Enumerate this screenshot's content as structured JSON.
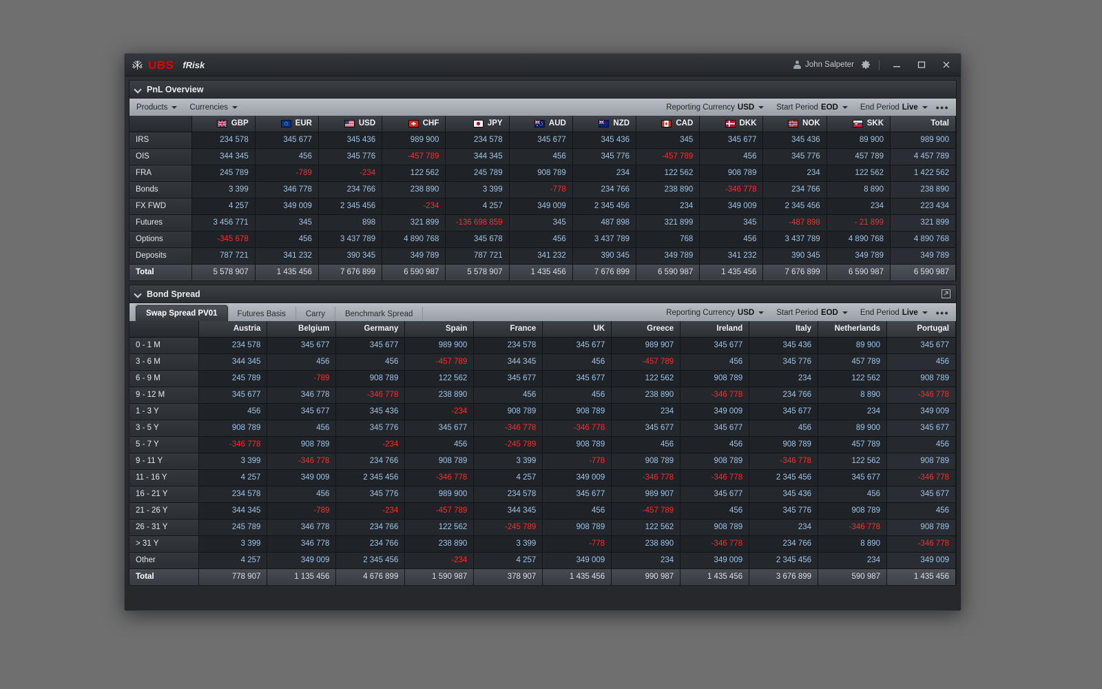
{
  "titlebar": {
    "brand": "UBS",
    "product": "fRisk",
    "user": "John Salpeter",
    "icons": {
      "user": "user-icon",
      "gear": "gear-icon",
      "minimize": "minimize-icon",
      "maximize": "maximize-icon",
      "close": "close-icon"
    }
  },
  "pnl": {
    "title": "PnL Overview",
    "toolbar_left": [
      {
        "label": "Products"
      },
      {
        "label": "Currencies"
      }
    ],
    "toolbar_right": [
      {
        "label": "Reporting Currency",
        "value": "USD"
      },
      {
        "label": "Start Period",
        "value": "EOD"
      },
      {
        "label": "End Period",
        "value": "Live"
      }
    ],
    "more": "•••",
    "row_header": "",
    "columns": [
      {
        "code": "GBP",
        "flag": "gb"
      },
      {
        "code": "EUR",
        "flag": "eu"
      },
      {
        "code": "USD",
        "flag": "us"
      },
      {
        "code": "CHF",
        "flag": "ch"
      },
      {
        "code": "JPY",
        "flag": "jp"
      },
      {
        "code": "AUD",
        "flag": "au"
      },
      {
        "code": "NZD",
        "flag": "nz"
      },
      {
        "code": "CAD",
        "flag": "ca"
      },
      {
        "code": "DKK",
        "flag": "dk"
      },
      {
        "code": "NOK",
        "flag": "no"
      },
      {
        "code": "SKK",
        "flag": "sk"
      }
    ],
    "total_column": "Total",
    "rows": [
      {
        "label": "IRS",
        "values": [
          "234 578",
          "345 677",
          "345 436",
          "989 900",
          "234 578",
          "345 677",
          "345 436",
          "345",
          "345 677",
          "345 436",
          "89 900"
        ],
        "total": "989 900"
      },
      {
        "label": "OIS",
        "values": [
          "344 345",
          "456",
          "345 776",
          "-457 789",
          "344 345",
          "456",
          "345 776",
          "-457 789",
          "456",
          "345 776",
          "457 789"
        ],
        "total": "4 457 789"
      },
      {
        "label": "FRA",
        "values": [
          "245 789",
          "-789",
          "-234",
          "122 562",
          "245 789",
          "908 789",
          "234",
          "122 562",
          "908 789",
          "234",
          "122 562"
        ],
        "total": "1 422 562"
      },
      {
        "label": "Bonds",
        "values": [
          "3 399",
          "346 778",
          "234 766",
          "238 890",
          "3 399",
          "-778",
          "234 766",
          "238 890",
          "-346 778",
          "234 766",
          "8 890"
        ],
        "total": "238 890"
      },
      {
        "label": "FX FWD",
        "values": [
          "4 257",
          "349 009",
          "2 345 456",
          "-234",
          "4 257",
          "349 009",
          "2 345 456",
          "234",
          "349 009",
          "2 345 456",
          "234"
        ],
        "total": "223 434"
      },
      {
        "label": "Futures",
        "values": [
          "3 456 771",
          "345",
          "898",
          "321 899",
          "-136 698 859",
          "345",
          "487 898",
          "321 899",
          "345",
          "-487 898",
          "- 21 899"
        ],
        "total": "321 899"
      },
      {
        "label": "Options",
        "values": [
          "-345 678",
          "456",
          "3 437 789",
          "4 890 768",
          "345 678",
          "456",
          "3 437 789",
          "768",
          "456",
          "3 437 789",
          "4 890 768"
        ],
        "total": "4 890 768"
      },
      {
        "label": "Deposits",
        "values": [
          "787 721",
          "341 232",
          "390 345",
          "349 789",
          "787 721",
          "341 232",
          "390 345",
          "349 789",
          "341 232",
          "390 345",
          "349 789"
        ],
        "total": "349 789"
      }
    ],
    "total_row": {
      "label": "Total",
      "values": [
        "5 578 907",
        "1 435 456",
        "7 676 899",
        "6 590 987",
        "5 578 907",
        "1 435 456",
        "7 676 899",
        "6 590 987",
        "1 435 456",
        "7 676 899",
        "6 590 987"
      ],
      "total": "6 590 987"
    }
  },
  "bond": {
    "title": "Bond Spread",
    "popout_icon": "popout-icon",
    "tabs": [
      {
        "label": "Swap Spread PV01",
        "active": true
      },
      {
        "label": "Futures Basis",
        "active": false
      },
      {
        "label": "Carry",
        "active": false
      },
      {
        "label": "Benchmark Spread",
        "active": false
      }
    ],
    "toolbar_right": [
      {
        "label": "Reporting Currency",
        "value": "USD"
      },
      {
        "label": "Start Period",
        "value": "EOD"
      },
      {
        "label": "End Period",
        "value": "Live"
      }
    ],
    "more": "•••",
    "columns": [
      "Austria",
      "Belgium",
      "Germany",
      "Spain",
      "France",
      "UK",
      "Greece",
      "Ireland",
      "Italy",
      "Netherlands",
      "Portugal"
    ],
    "rows": [
      {
        "label": "0 - 1 M",
        "values": [
          "234 578",
          "345 677",
          "345 677",
          "989 900",
          "234 578",
          "345 677",
          "989 907",
          "345 677",
          "345 436",
          "89 900",
          "345 677"
        ]
      },
      {
        "label": "3 - 6 M",
        "values": [
          "344 345",
          "456",
          "456",
          "-457 789",
          "344 345",
          "456",
          "-457 789",
          "456",
          "345 776",
          "457 789",
          "456"
        ]
      },
      {
        "label": "6 - 9 M",
        "values": [
          "245 789",
          "-789",
          "908 789",
          "122 562",
          "345 677",
          "345 677",
          "122 562",
          "908 789",
          "234",
          "122 562",
          "908 789"
        ]
      },
      {
        "label": "9 - 12 M",
        "values": [
          "345 677",
          "346 778",
          "-346 778",
          "238 890",
          "456",
          "456",
          "238 890",
          "-346 778",
          "234 766",
          "8 890",
          "-346 778"
        ]
      },
      {
        "label": "1 - 3 Y",
        "values": [
          "456",
          "345 677",
          "345 436",
          "-234",
          "908 789",
          "908 789",
          "234",
          "349 009",
          "345 677",
          "234",
          "349 009"
        ]
      },
      {
        "label": "3 - 5 Y",
        "values": [
          "908 789",
          "456",
          "345 776",
          "345 677",
          "-346 778",
          "-346 778",
          "345 677",
          "345 677",
          "456",
          "89 900",
          "345 677"
        ]
      },
      {
        "label": "5 - 7 Y",
        "values": [
          "-346 778",
          "908 789",
          "-234",
          "456",
          "-245 789",
          "908 789",
          "456",
          "456",
          "908 789",
          "457 789",
          "456"
        ]
      },
      {
        "label": "9 - 11 Y",
        "values": [
          "3 399",
          "-346 778",
          "234 766",
          "908 789",
          "3 399",
          "-778",
          "908 789",
          "908 789",
          "-346 778",
          "122 562",
          "908 789"
        ]
      },
      {
        "label": "11 - 16 Y",
        "values": [
          "4 257",
          "349 009",
          "2 345 456",
          "-346 778",
          "4 257",
          "349 009",
          "-346 778",
          "-346 778",
          "2 345 456",
          "345 677",
          "-346 778"
        ]
      },
      {
        "label": "16 - 21 Y",
        "values": [
          "234 578",
          "456",
          "345 776",
          "989 900",
          "234 578",
          "345 677",
          "989 907",
          "345 677",
          "345 436",
          "456",
          "345 677"
        ]
      },
      {
        "label": "21 - 26 Y",
        "values": [
          "344 345",
          "-789",
          "-234",
          "-457 789",
          "344 345",
          "456",
          "-457 789",
          "456",
          "345 776",
          "908 789",
          "456"
        ]
      },
      {
        "label": "26 - 31 Y",
        "values": [
          "245 789",
          "346 778",
          "234 766",
          "122 562",
          "-245 789",
          "908 789",
          "122 562",
          "908 789",
          "234",
          "-346 778",
          "908 789"
        ]
      },
      {
        "label": "> 31 Y",
        "values": [
          "3 399",
          "346 778",
          "234 766",
          "238 890",
          "3 399",
          "-778",
          "238 890",
          "-346 778",
          "234 766",
          "8 890",
          "-346 778"
        ]
      },
      {
        "label": "Other",
        "values": [
          "4 257",
          "349 009",
          "2 345 456",
          "-234",
          "4 257",
          "349 009",
          "234",
          "349 009",
          "2 345 456",
          "234",
          "349 009"
        ]
      }
    ],
    "total_row": {
      "label": "Total",
      "values": [
        "778 907",
        "1 135 456",
        "4 676 899",
        "1 590 987",
        "378 907",
        "1 435 456",
        "990 987",
        "1 435 456",
        "3 676 899",
        "590 987",
        "1 435 456"
      ]
    }
  }
}
